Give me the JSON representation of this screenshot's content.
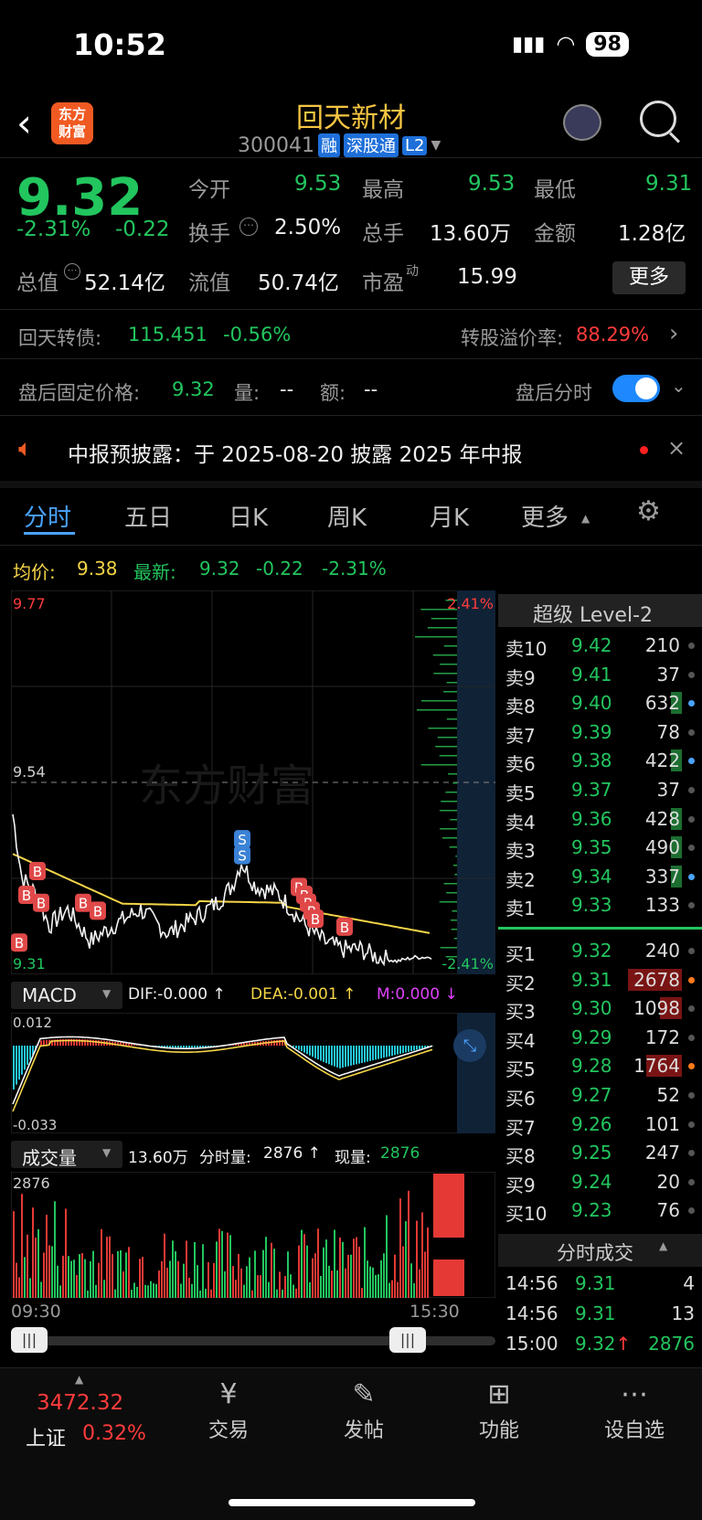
{
  "status": {
    "time": "10:52",
    "battery": "98"
  },
  "header": {
    "title": "回天新材",
    "code": "300041",
    "tags": [
      "融",
      "深股通",
      "L2"
    ],
    "logo_text": "东方\n财富"
  },
  "quote": {
    "price": "9.32",
    "pct": "-2.31%",
    "chg": "-0.22",
    "open_label": "今开",
    "open": "9.53",
    "high_label": "最高",
    "high": "9.53",
    "low_label": "最低",
    "low": "9.31",
    "turnover_label": "换手",
    "turnover": "2.50%",
    "vol_label": "总手",
    "vol": "13.60万",
    "amt_label": "金额",
    "amt": "1.28亿",
    "mcap_label": "总值",
    "mcap": "52.14亿",
    "float_label": "流值",
    "float": "50.74亿",
    "pe_label": "市盈",
    "pe_sup": "动",
    "pe": "15.99",
    "more": "更多"
  },
  "bond": {
    "label": "回天转债:",
    "price": "115.451",
    "pct": "-0.56%",
    "premium_label": "转股溢价率:",
    "premium": "88.29%"
  },
  "afterhours": {
    "label": "盘后固定价格:",
    "price": "9.32",
    "vol_label": "量:",
    "vol": "--",
    "amt_label": "额:",
    "amt": "--",
    "toggle_label": "盘后分时"
  },
  "notice": {
    "text": "中报预披露：于 2025-08-20 披露 2025 年中报"
  },
  "tabs": [
    "分时",
    "五日",
    "日K",
    "周K",
    "月K",
    "更多"
  ],
  "summary": {
    "avg_label": "均价:",
    "avg": "9.38",
    "latest_label": "最新:",
    "latest": "9.32",
    "chg": "-0.22",
    "pct": "-2.31%"
  },
  "chart": {
    "ymax": "9.77",
    "ymid": "9.54",
    "ymin": "9.31",
    "pct_top": "2.41%",
    "pct_bottom": "-2.41%",
    "watermark": "东方财富",
    "time_start": "09:30",
    "time_end": "15:30"
  },
  "macd": {
    "name": "MACD",
    "dif": "DIF:-0.000 ↑",
    "dea": "DEA:-0.001 ↑",
    "m": "M:0.000 ↓",
    "top": "0.012",
    "bottom": "-0.033"
  },
  "volume": {
    "name": "成交量",
    "total": "13.60万",
    "fs_label": "分时量:",
    "fs": "2876 ↑",
    "now_label": "现量:",
    "now": "2876",
    "ymax": "2876"
  },
  "orderbook": {
    "title": "超级 Level-2",
    "asks": [
      {
        "label": "卖10",
        "price": "9.42",
        "vol": "210"
      },
      {
        "label": "卖9",
        "price": "9.41",
        "vol": "37"
      },
      {
        "label": "卖8",
        "price": "9.40",
        "vol": "632"
      },
      {
        "label": "卖7",
        "price": "9.39",
        "vol": "78"
      },
      {
        "label": "卖6",
        "price": "9.38",
        "vol": "422"
      },
      {
        "label": "卖5",
        "price": "9.37",
        "vol": "37"
      },
      {
        "label": "卖4",
        "price": "9.36",
        "vol": "428"
      },
      {
        "label": "卖3",
        "price": "9.35",
        "vol": "490"
      },
      {
        "label": "卖2",
        "price": "9.34",
        "vol": "337"
      },
      {
        "label": "卖1",
        "price": "9.33",
        "vol": "133"
      }
    ],
    "bids": [
      {
        "label": "买1",
        "price": "9.32",
        "vol": "240"
      },
      {
        "label": "买2",
        "price": "9.31",
        "vol": "2678"
      },
      {
        "label": "买3",
        "price": "9.30",
        "vol": "1098"
      },
      {
        "label": "买4",
        "price": "9.29",
        "vol": "172"
      },
      {
        "label": "买5",
        "price": "9.28",
        "vol": "1764"
      },
      {
        "label": "买6",
        "price": "9.27",
        "vol": "52"
      },
      {
        "label": "买7",
        "price": "9.26",
        "vol": "101"
      },
      {
        "label": "买8",
        "price": "9.25",
        "vol": "247"
      },
      {
        "label": "买9",
        "price": "9.24",
        "vol": "20"
      },
      {
        "label": "买10",
        "price": "9.23",
        "vol": "76"
      }
    ]
  },
  "ticks": {
    "title": "分时成交",
    "rows": [
      {
        "time": "14:56",
        "price": "9.31",
        "vol": "4"
      },
      {
        "time": "14:56",
        "price": "9.31",
        "vol": "13"
      },
      {
        "time": "15:00",
        "price": "9.32↑",
        "vol": "2876"
      }
    ]
  },
  "index": {
    "value": "3472.32",
    "name": "上证",
    "pct": "0.32%"
  },
  "nav": [
    {
      "label": "交易",
      "icon": "¥"
    },
    {
      "label": "发帖",
      "icon": "✎"
    },
    {
      "label": "功能",
      "icon": "⊞"
    },
    {
      "label": "设自选",
      "icon": "⋯"
    }
  ],
  "colors": {
    "up": "#ff3b3b",
    "down": "#22c55e",
    "avg": "#f5d547",
    "accent": "#4aa3ff"
  }
}
